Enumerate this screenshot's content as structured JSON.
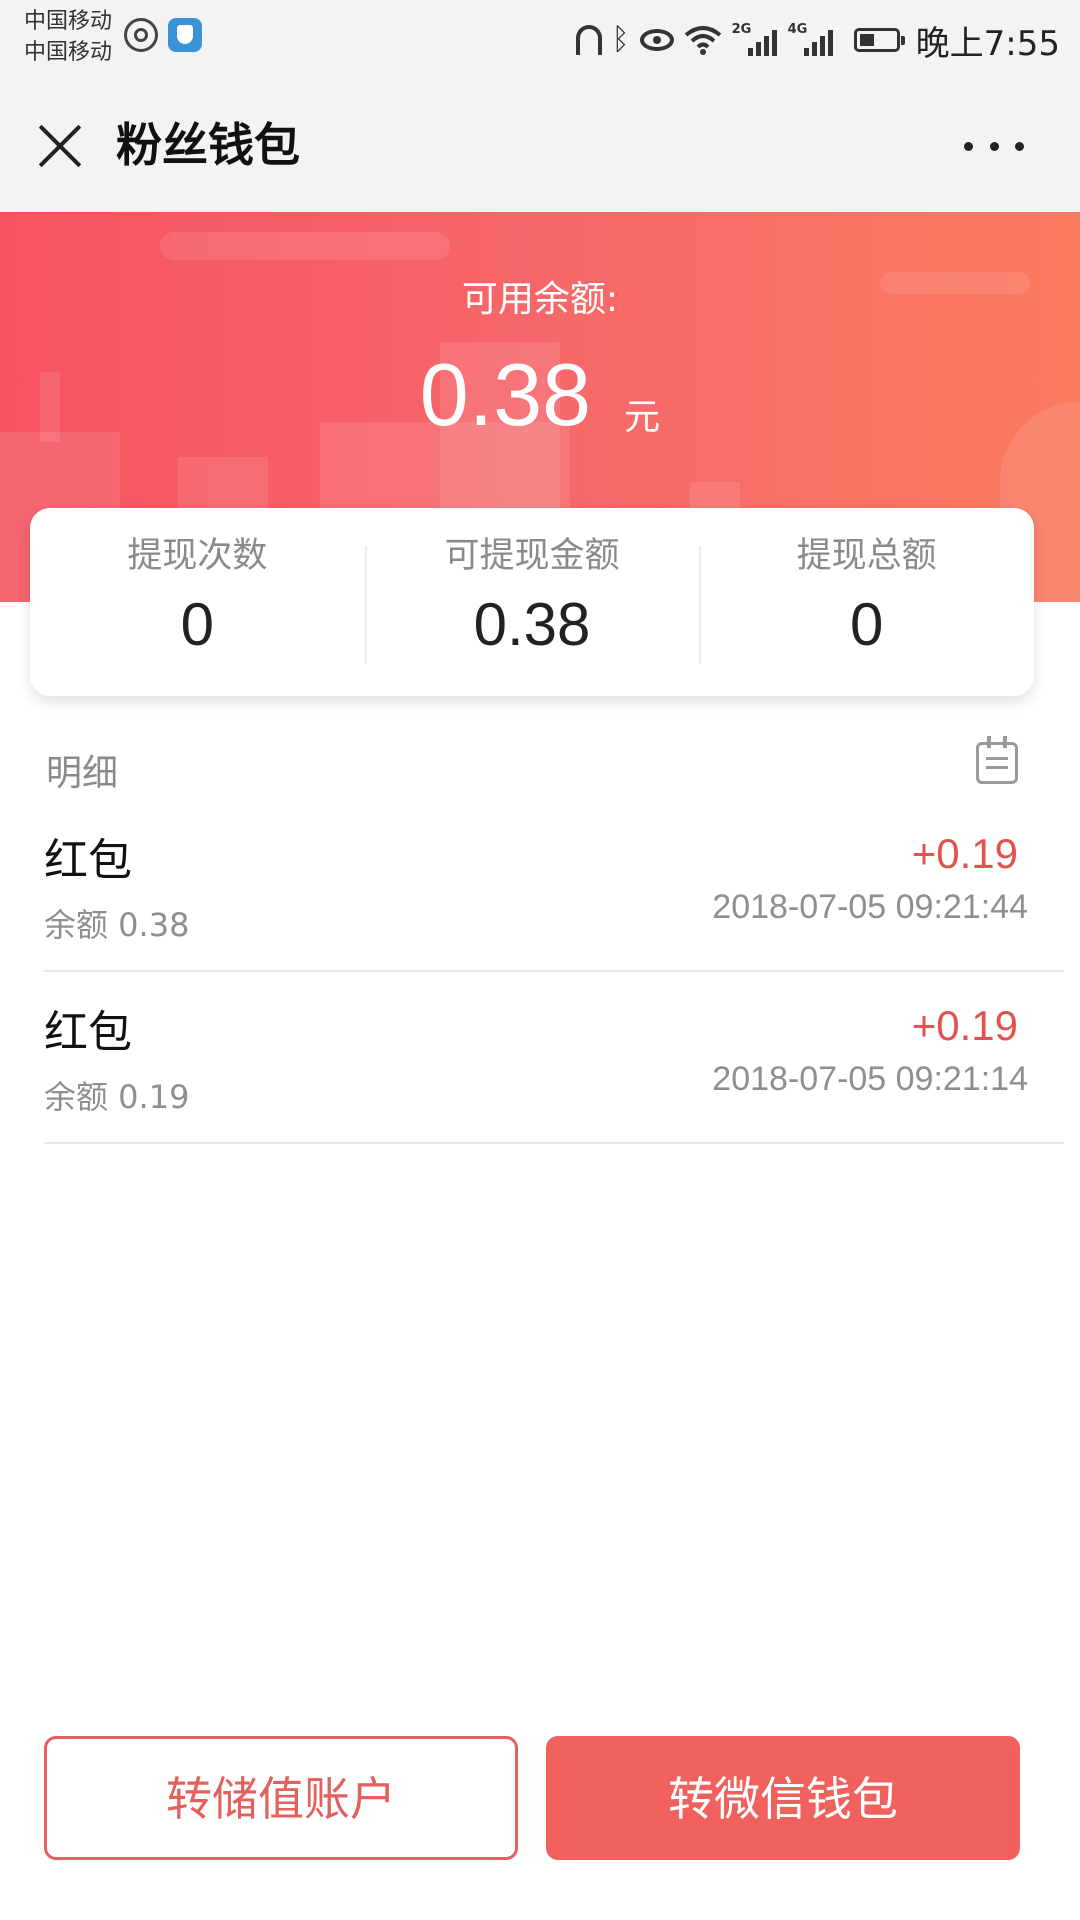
{
  "status_bar": {
    "carriers": [
      "中国移动",
      "中国移动"
    ],
    "network_tags": [
      "2G",
      "4G"
    ],
    "time": "晚上7:55",
    "icons": [
      "weibo-icon",
      "shield-app-icon",
      "headset-icon",
      "bluetooth-icon",
      "eye-icon",
      "wifi-icon",
      "signal-icon",
      "battery-icon"
    ]
  },
  "nav": {
    "title": "粉丝钱包",
    "close_icon": "close-icon",
    "more_icon": "more-icon"
  },
  "balance": {
    "label": "可用余额:",
    "amount": "0.38",
    "unit": "元"
  },
  "stats": [
    {
      "label": "提现次数",
      "value": "0"
    },
    {
      "label": "可提现金额",
      "value": "0.38"
    },
    {
      "label": "提现总额",
      "value": "0"
    }
  ],
  "details": {
    "title": "明细",
    "records": [
      {
        "type": "红包",
        "balance": "余额 0.38",
        "amount": "+0.19",
        "time": "2018-07-05 09:21:44"
      },
      {
        "type": "红包",
        "balance": "余额 0.19",
        "amount": "+0.19",
        "time": "2018-07-05 09:21:14"
      }
    ]
  },
  "buttons": {
    "transfer_stored": "转储值账户",
    "transfer_wechat": "转微信钱包"
  },
  "colors": {
    "accent": "#f0605c",
    "amount_positive": "#e4524e",
    "banner_start": "#f5535f",
    "banner_end": "#fb7a5f"
  }
}
